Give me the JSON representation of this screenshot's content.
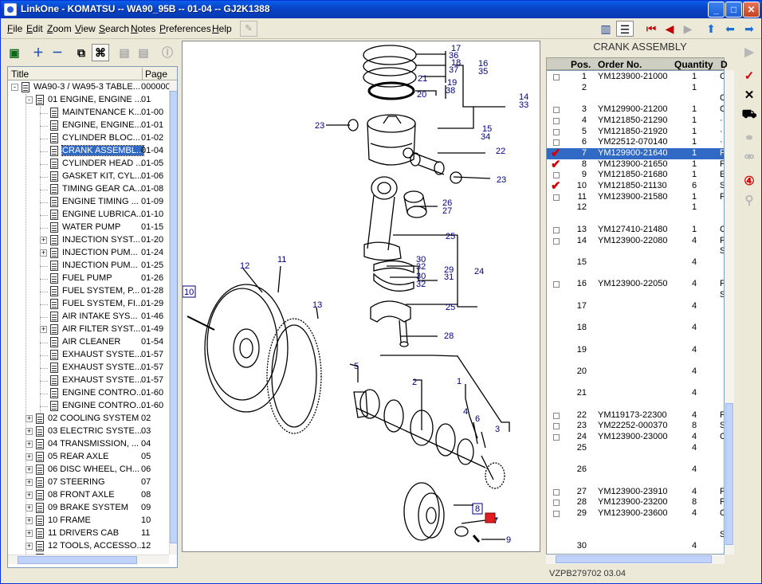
{
  "window": {
    "title": "LinkOne - KOMATSU -- WA90_95B -- 01-04 -- GJ2K1388"
  },
  "menu": [
    {
      "key": "F",
      "rest": "ile"
    },
    {
      "key": "E",
      "rest": "dit"
    },
    {
      "key": "Z",
      "rest": "oom"
    },
    {
      "key": "V",
      "rest": "iew"
    },
    {
      "key": "S",
      "rest": "earch"
    },
    {
      "key": "N",
      "rest": "otes"
    },
    {
      "key": "P",
      "rest": "references"
    },
    {
      "key": "H",
      "rest": "elp"
    }
  ],
  "tree": {
    "headers": {
      "title": "Title",
      "page": "Page"
    },
    "rows": [
      {
        "level": 0,
        "exp": "-",
        "label": "WA90-3 / WA95-3 TABLE...",
        "page": "000000"
      },
      {
        "level": 1,
        "exp": "-",
        "label": "01 ENGINE, ENGINE ...",
        "page": "01"
      },
      {
        "level": 2,
        "exp": "",
        "label": "MAINTENANCE K...",
        "page": "01-00"
      },
      {
        "level": 2,
        "exp": "",
        "label": "ENGINE, ENGINE...",
        "page": "01-01"
      },
      {
        "level": 2,
        "exp": "",
        "label": "CYLINDER BLOC...",
        "page": "01-02"
      },
      {
        "level": 2,
        "exp": "",
        "label": "CRANK ASSEMBL...",
        "page": "01-04",
        "selected": true
      },
      {
        "level": 2,
        "exp": "",
        "label": "CYLINDER HEAD ...",
        "page": "01-05"
      },
      {
        "level": 2,
        "exp": "",
        "label": "GASKET KIT, CYL...",
        "page": "01-06"
      },
      {
        "level": 2,
        "exp": "",
        "label": "TIMING GEAR CA...",
        "page": "01-08"
      },
      {
        "level": 2,
        "exp": "",
        "label": "ENGINE TIMING ...",
        "page": "01-09"
      },
      {
        "level": 2,
        "exp": "",
        "label": "ENGINE LUBRICA...",
        "page": "01-10"
      },
      {
        "level": 2,
        "exp": "",
        "label": "WATER PUMP",
        "page": "01-15"
      },
      {
        "level": 2,
        "exp": "+",
        "label": "INJECTION SYST...",
        "page": "01-20"
      },
      {
        "level": 2,
        "exp": "+",
        "label": "INJECTION PUM...",
        "page": "01-24"
      },
      {
        "level": 2,
        "exp": "",
        "label": "INJECTION PUM...",
        "page": "01-25"
      },
      {
        "level": 2,
        "exp": "",
        "label": "FUEL PUMP",
        "page": "01-26"
      },
      {
        "level": 2,
        "exp": "",
        "label": "FUEL SYSTEM, P...",
        "page": "01-28"
      },
      {
        "level": 2,
        "exp": "",
        "label": "FUEL SYSTEM, FI...",
        "page": "01-29"
      },
      {
        "level": 2,
        "exp": "",
        "label": "AIR INTAKE SYS...",
        "page": "01-46"
      },
      {
        "level": 2,
        "exp": "+",
        "label": "AIR FILTER SYST...",
        "page": "01-49"
      },
      {
        "level": 2,
        "exp": "",
        "label": "AIR CLEANER",
        "page": "01-54"
      },
      {
        "level": 2,
        "exp": "",
        "label": "EXHAUST SYSTE...",
        "page": "01-57"
      },
      {
        "level": 2,
        "exp": "",
        "label": "EXHAUST SYSTE...",
        "page": "01-57"
      },
      {
        "level": 2,
        "exp": "",
        "label": "EXHAUST SYSTE...",
        "page": "01-57"
      },
      {
        "level": 2,
        "exp": "",
        "label": "ENGINE CONTRO...",
        "page": "01-60"
      },
      {
        "level": 2,
        "exp": "",
        "label": "ENGINE CONTRO...",
        "page": "01-60"
      },
      {
        "level": 1,
        "exp": "+",
        "label": "02 COOLING SYSTEM",
        "page": "02"
      },
      {
        "level": 1,
        "exp": "+",
        "label": "03 ELECTRIC SYSTE...",
        "page": "03"
      },
      {
        "level": 1,
        "exp": "+",
        "label": "04 TRANSMISSION, ...",
        "page": "04"
      },
      {
        "level": 1,
        "exp": "+",
        "label": "05 REAR AXLE",
        "page": "05"
      },
      {
        "level": 1,
        "exp": "+",
        "label": "06 DISC WHEEL, CH...",
        "page": "06"
      },
      {
        "level": 1,
        "exp": "+",
        "label": "07 STEERING",
        "page": "07"
      },
      {
        "level": 1,
        "exp": "+",
        "label": "08 FRONT AXLE",
        "page": "08"
      },
      {
        "level": 1,
        "exp": "+",
        "label": "09 BRAKE SYSTEM",
        "page": "09"
      },
      {
        "level": 1,
        "exp": "+",
        "label": "10 FRAME",
        "page": "10"
      },
      {
        "level": 1,
        "exp": "+",
        "label": "11 DRIVERS CAB",
        "page": "11"
      },
      {
        "level": 1,
        "exp": "+",
        "label": "12 TOOLS, ACCESSO...",
        "page": "12"
      },
      {
        "level": 1,
        "exp": "+",
        "label": "13 HYDRAULIC SYST...",
        "page": "13"
      }
    ]
  },
  "parts_list": {
    "title": "CRANK ASSEMBLY",
    "headers": {
      "pos": "Pos.",
      "order": "Order No.",
      "qty": "Quantity",
      "d": "D"
    },
    "rows": [
      {
        "pos": "1",
        "order": "YM123900-21000",
        "qty": "1",
        "d": "C",
        "box": true
      },
      {
        "pos": "2",
        "order": "",
        "qty": "1",
        "d": "",
        "box": false
      },
      {
        "pos": "",
        "order": "",
        "qty": "",
        "d": "C",
        "box": false
      },
      {
        "pos": "3",
        "order": "YM129900-21200",
        "qty": "1",
        "d": "C",
        "box": true
      },
      {
        "pos": "4",
        "order": "YM121850-21290",
        "qty": "1",
        "d": "·",
        "box": true
      },
      {
        "pos": "5",
        "order": "YM121850-21920",
        "qty": "1",
        "d": "·",
        "box": true
      },
      {
        "pos": "6",
        "order": "YM22512-070140",
        "qty": "1",
        "d": "·",
        "box": true
      },
      {
        "pos": "7",
        "order": "YM129900-21640",
        "qty": "1",
        "d": "F",
        "box": true,
        "checked": true,
        "selected": true
      },
      {
        "pos": "8",
        "order": "YM123900-21650",
        "qty": "1",
        "d": "F",
        "box": true,
        "checked": true
      },
      {
        "pos": "9",
        "order": "YM121850-21680",
        "qty": "1",
        "d": "E",
        "box": true
      },
      {
        "pos": "10",
        "order": "YM121850-21130",
        "qty": "6",
        "d": "S",
        "box": true,
        "checked": true
      },
      {
        "pos": "11",
        "order": "YM123900-21580",
        "qty": "1",
        "d": "F",
        "box": true
      },
      {
        "pos": "12",
        "order": "",
        "qty": "1",
        "d": "",
        "box": false
      },
      {
        "pos": "",
        "order": "",
        "qty": "",
        "d": "",
        "box": false
      },
      {
        "pos": "13",
        "order": "YM127410-21480",
        "qty": "1",
        "d": "C",
        "box": true
      },
      {
        "pos": "14",
        "order": "YM123900-22080",
        "qty": "4",
        "d": "F",
        "box": true
      },
      {
        "pos": "",
        "order": "",
        "qty": "",
        "d": "S",
        "box": false
      },
      {
        "pos": "15",
        "order": "",
        "qty": "4",
        "d": "",
        "box": false
      },
      {
        "pos": "",
        "order": "",
        "qty": "",
        "d": "",
        "box": false
      },
      {
        "pos": "16",
        "order": "YM123900-22050",
        "qty": "4",
        "d": "F",
        "box": true
      },
      {
        "pos": "",
        "order": "",
        "qty": "",
        "d": "S",
        "box": false
      },
      {
        "pos": "17",
        "order": "",
        "qty": "4",
        "d": "",
        "box": false
      },
      {
        "pos": "",
        "order": "",
        "qty": "",
        "d": "",
        "box": false
      },
      {
        "pos": "18",
        "order": "",
        "qty": "4",
        "d": "",
        "box": false
      },
      {
        "pos": "",
        "order": "",
        "qty": "",
        "d": "",
        "box": false
      },
      {
        "pos": "19",
        "order": "",
        "qty": "4",
        "d": "",
        "box": false
      },
      {
        "pos": "",
        "order": "",
        "qty": "",
        "d": "",
        "box": false
      },
      {
        "pos": "20",
        "order": "",
        "qty": "4",
        "d": "",
        "box": false
      },
      {
        "pos": "",
        "order": "",
        "qty": "",
        "d": "",
        "box": false
      },
      {
        "pos": "21",
        "order": "",
        "qty": "4",
        "d": "",
        "box": false
      },
      {
        "pos": "",
        "order": "",
        "qty": "",
        "d": "",
        "box": false
      },
      {
        "pos": "22",
        "order": "YM119173-22300",
        "qty": "4",
        "d": "F",
        "box": true
      },
      {
        "pos": "23",
        "order": "YM22252-000370",
        "qty": "8",
        "d": "S",
        "box": true
      },
      {
        "pos": "24",
        "order": "YM123900-23000",
        "qty": "4",
        "d": "C",
        "box": true
      },
      {
        "pos": "25",
        "order": "",
        "qty": "4",
        "d": "",
        "box": false
      },
      {
        "pos": "",
        "order": "",
        "qty": "",
        "d": "",
        "box": false
      },
      {
        "pos": "26",
        "order": "",
        "qty": "4",
        "d": "",
        "box": false
      },
      {
        "pos": "",
        "order": "",
        "qty": "",
        "d": "",
        "box": false
      },
      {
        "pos": "27",
        "order": "YM123900-23910",
        "qty": "4",
        "d": "F",
        "box": true
      },
      {
        "pos": "28",
        "order": "YM123900-23200",
        "qty": "8",
        "d": "F",
        "box": true
      },
      {
        "pos": "29",
        "order": "YM123900-23600",
        "qty": "4",
        "d": "C",
        "box": true
      },
      {
        "pos": "",
        "order": "",
        "qty": "",
        "d": "",
        "box": false
      },
      {
        "pos": "",
        "order": "",
        "qty": "",
        "d": "S",
        "box": false
      },
      {
        "pos": "30",
        "order": "",
        "qty": "4",
        "d": "",
        "box": false
      }
    ]
  },
  "drawing": {
    "callouts": [
      "17",
      "36",
      "18",
      "37",
      "16",
      "35",
      "21",
      "19",
      "38",
      "20",
      "14",
      "33",
      "23",
      "15",
      "34",
      "22",
      "23",
      "26",
      "27",
      "25",
      "30",
      "32",
      "29",
      "31",
      "24",
      "30",
      "32",
      "25",
      "28",
      "12",
      "11",
      "10",
      "13",
      "5",
      "2",
      "1",
      "4",
      "6",
      "3",
      "8",
      "7",
      "9"
    ]
  },
  "status": {
    "text": "VZPB279702 03.04"
  },
  "colors": {
    "accent": "#316ac5",
    "callout": "#00007f",
    "check": "#d00000"
  }
}
